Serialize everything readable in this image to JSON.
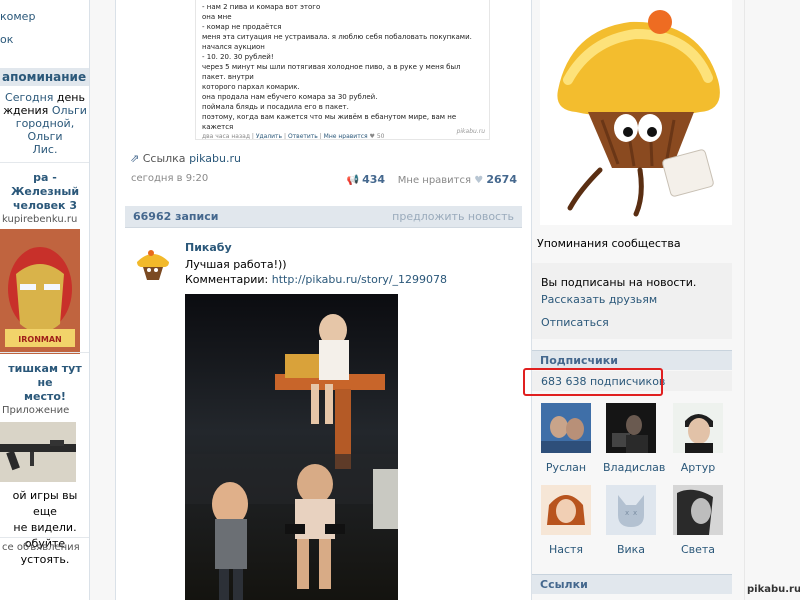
{
  "left": {
    "top_items": [
      "комер",
      "ок"
    ],
    "mention": {
      "header": "апоминание",
      "line1_link": "Сегодня",
      "line1_rest": "день",
      "line2": "ждения",
      "line2_link": "Ольги",
      "line3": "городной, Ольги",
      "line4": "Лис."
    },
    "ad1": {
      "title_l1": "ра - Железный",
      "title_l2": "человек 3",
      "source": "kupirebenku.ru"
    },
    "ad2": {
      "title_l1": "тишкам тут не",
      "title_l2": "место!",
      "source": "Приложение"
    },
    "ad3": {
      "l1": "ой игры вы еще",
      "l2": "не видели.",
      "l3": "обуйте устоять."
    },
    "all_ads": "се объявления"
  },
  "screenshot_text": {
    "lines": [
      "- нам 2 пива и комара вот этого",
      "она мне",
      "- комар не продаётся",
      "меня эта ситуация не устраивала. я люблю себя побаловать покупками.",
      "начался аукцион",
      "- 10. 20. 30 рублей!",
      "через 5 минут мы шли потягивая холодное пиво, а в руке у меня был пакет. внутри",
      "которого пархал комарик.",
      "она продала нам ебучего комара за 30 рублей.",
      "поймала блядь и посадила его в пакет.",
      "поэтому, когда вам кажется что мы живём в ебанутом мире, вам не кажется"
    ],
    "footer_time": "два часа назад",
    "footer_delete": "Удалить",
    "footer_reply": "Ответить",
    "footer_like": "Мне нравится",
    "footer_like_count": "50",
    "watermark": "pikabu.ru"
  },
  "post_meta": {
    "source_prefix": "Ссылка",
    "source_link": "pikabu.ru",
    "date": "сегодня в 9:20",
    "reposts": "434",
    "like_label": "Мне нравится",
    "likes": "2674"
  },
  "wall": {
    "count": "66962 записи",
    "suggest": "предложить новость"
  },
  "post": {
    "author": "Пикабу",
    "text": "Лучшая работа!))",
    "comments_label": "Комментарии:",
    "comments_link": "http://pikabu.ru/story/_1299078"
  },
  "right": {
    "mentions": "Упоминания сообщества",
    "subscribed": "Вы подписаны на новости.",
    "tell_friends": "Рассказать друзьям",
    "unsubscribe": "Отписаться",
    "subscribers_header": "Подписчики",
    "subscribers_count": "683 638 подписчиков",
    "members": [
      {
        "name": "Руслан"
      },
      {
        "name": "Владислав"
      },
      {
        "name": "Артур"
      },
      {
        "name": "Настя"
      },
      {
        "name": "Вика"
      },
      {
        "name": "Света"
      }
    ],
    "links_header": "Ссылки"
  },
  "watermark": "pikabu.ru",
  "colors": {
    "link": "#2b587a",
    "header_bg": "#e1e7ed",
    "highlight": "#e02020"
  }
}
